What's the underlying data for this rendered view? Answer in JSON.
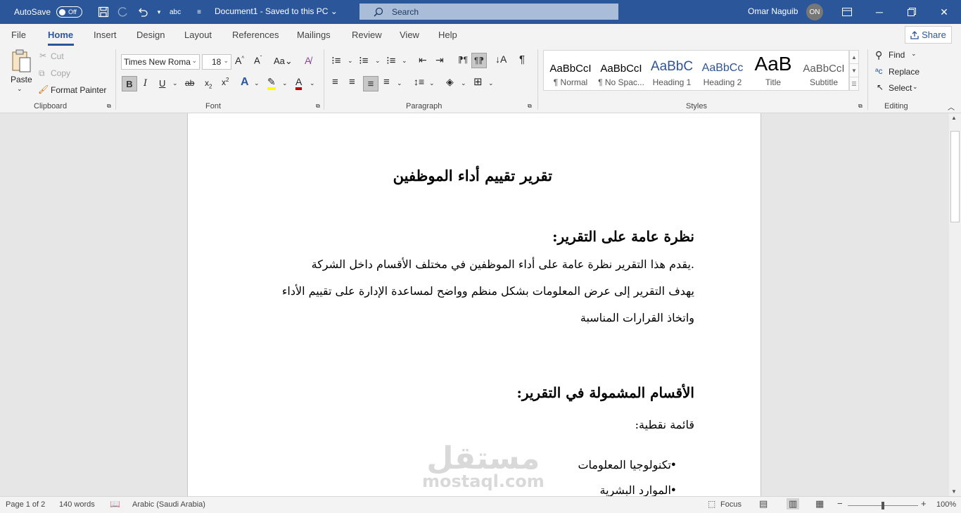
{
  "titlebar": {
    "autosave_label": "AutoSave",
    "autosave_state": "Off",
    "doc_title": "Document1  -  Saved to this PC  ⌄",
    "search_placeholder": "Search",
    "user_name": "Omar Naguib",
    "user_initials": "ON"
  },
  "tabs": [
    "File",
    "Home",
    "Insert",
    "Design",
    "Layout",
    "References",
    "Mailings",
    "Review",
    "View",
    "Help"
  ],
  "share_label": "Share",
  "ribbon": {
    "clipboard": {
      "paste": "Paste",
      "cut": "Cut",
      "copy": "Copy",
      "format_painter": "Format Painter",
      "label": "Clipboard"
    },
    "font": {
      "font_name": "Times New Roma",
      "font_size": "18",
      "label": "Font"
    },
    "paragraph": {
      "label": "Paragraph"
    },
    "styles": {
      "label": "Styles",
      "items": [
        {
          "preview": "AaBbCcI",
          "name": "¶ Normal"
        },
        {
          "preview": "AaBbCcI",
          "name": "¶ No Spac..."
        },
        {
          "preview": "AaBbC",
          "name": "Heading 1"
        },
        {
          "preview": "AaBbCc",
          "name": "Heading 2"
        },
        {
          "preview": "AaB",
          "name": "Title"
        },
        {
          "preview": "AaBbCcI",
          "name": "Subtitle"
        }
      ]
    },
    "editing": {
      "find": "Find",
      "replace": "Replace",
      "select": "Select",
      "label": "Editing"
    }
  },
  "document": {
    "title": "تقرير تقييم أداء الموظفين",
    "section1_heading": "نظرة عامة على التقرير:",
    "section1_line1": ".يقدم هذا التقرير نظرة عامة على أداء الموظفين في مختلف الأقسام داخل الشركة",
    "section1_line2": "يهدف التقرير إلى عرض المعلومات بشكل منظم وواضح لمساعدة الإدارة على تقييم الأداء",
    "section1_line3": "واتخاذ القرارات المناسبة",
    "section2_heading": "الأقسام المشمولة في التقرير:",
    "bullet_intro": "قائمة نقطية:",
    "bullets": [
      "تكنولوجيا المعلومات",
      "الموارد البشرية"
    ]
  },
  "watermark": {
    "arabic": "مستقل",
    "latin": "mostaql.com"
  },
  "statusbar": {
    "page": "Page 1 of 2",
    "words": "140 words",
    "language": "Arabic (Saudi Arabia)",
    "focus": "Focus",
    "zoom": "100%",
    "zoom_level": 1.0
  }
}
